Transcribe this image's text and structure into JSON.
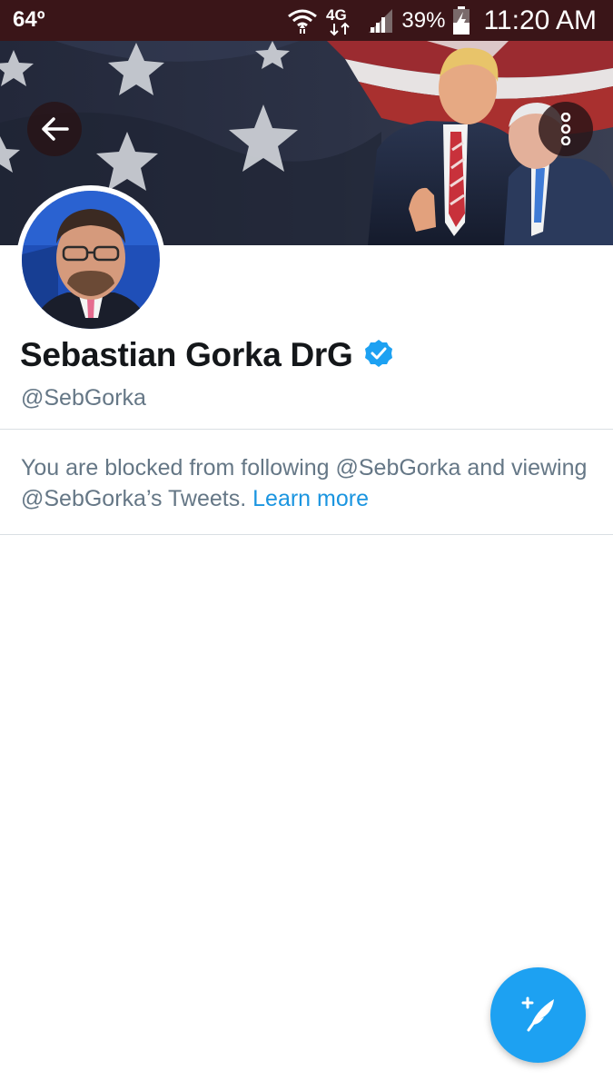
{
  "status_bar": {
    "temperature": "64º",
    "network_type": "4G",
    "battery_percent": "39%",
    "time": "11:20 AM",
    "icons": [
      "wifi-icon",
      "network-4g-icon",
      "signal-icon",
      "battery-charging-icon"
    ]
  },
  "header": {
    "back_icon": "arrow-left-icon",
    "more_icon": "more-vertical-icon"
  },
  "profile": {
    "name": "Sebastian Gorka DrG",
    "verified": true,
    "handle": "@SebGorka"
  },
  "blocked_notice": {
    "message": "You are blocked from following @SebGorka and viewing @SebGorka’s Tweets.",
    "link_label": "Learn more"
  },
  "compose": {
    "icon": "compose-tweet-icon"
  },
  "colors": {
    "status_bar": "#3a1518",
    "accent": "#1da1f2",
    "link": "#1b95e0",
    "secondary_text": "#657786",
    "primary_text": "#14171a"
  }
}
